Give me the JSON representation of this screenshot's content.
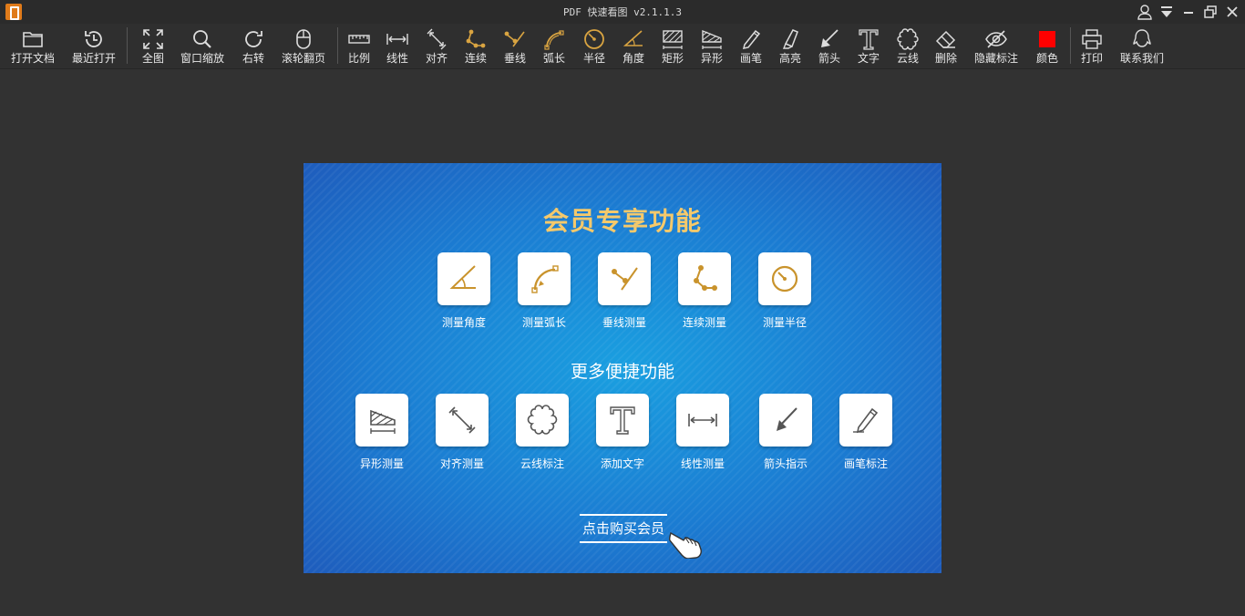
{
  "window": {
    "title": "PDF 快速看图 v2.1.1.3"
  },
  "toolbar": {
    "items": [
      {
        "label": "打开文档",
        "icon": "folder-icon"
      },
      {
        "label": "最近打开",
        "icon": "history-icon"
      },
      {
        "label": "全图",
        "icon": "fullscreen-icon"
      },
      {
        "label": "窗口缩放",
        "icon": "zoom-icon"
      },
      {
        "label": "右转",
        "icon": "rotate-right-icon"
      },
      {
        "label": "滚轮翻页",
        "icon": "mouse-icon"
      },
      {
        "label": "比例",
        "icon": "ruler-icon"
      },
      {
        "label": "线性",
        "icon": "linear-measure-icon"
      },
      {
        "label": "对齐",
        "icon": "align-measure-icon"
      },
      {
        "label": "连续",
        "icon": "continuous-measure-icon"
      },
      {
        "label": "垂线",
        "icon": "perpendicular-icon"
      },
      {
        "label": "弧长",
        "icon": "arc-length-icon"
      },
      {
        "label": "半径",
        "icon": "radius-icon"
      },
      {
        "label": "角度",
        "icon": "angle-icon"
      },
      {
        "label": "矩形",
        "icon": "rectangle-icon"
      },
      {
        "label": "异形",
        "icon": "irregular-shape-icon"
      },
      {
        "label": "画笔",
        "icon": "pen-icon"
      },
      {
        "label": "高亮",
        "icon": "highlighter-icon"
      },
      {
        "label": "箭头",
        "icon": "arrow-icon"
      },
      {
        "label": "文字",
        "icon": "text-icon"
      },
      {
        "label": "云线",
        "icon": "cloud-line-icon"
      },
      {
        "label": "删除",
        "icon": "eraser-icon"
      },
      {
        "label": "隐藏标注",
        "icon": "hide-eye-icon"
      },
      {
        "label": "颜色",
        "icon": "color-swatch"
      },
      {
        "label": "打印",
        "icon": "printer-icon"
      },
      {
        "label": "联系我们",
        "icon": "contact-icon"
      }
    ],
    "colors": {
      "gold": "#d9a441",
      "icon": "#dcdcdc",
      "current_color": "#ff0000"
    }
  },
  "promo": {
    "title": "会员专享功能",
    "vip_features": [
      {
        "label": "测量角度",
        "icon": "angle-icon"
      },
      {
        "label": "测量弧长",
        "icon": "arc-length-icon"
      },
      {
        "label": "垂线测量",
        "icon": "perpendicular-icon"
      },
      {
        "label": "连续测量",
        "icon": "continuous-measure-icon"
      },
      {
        "label": "测量半径",
        "icon": "radius-icon"
      }
    ],
    "subtitle": "更多便捷功能",
    "more_features": [
      {
        "label": "异形测量",
        "icon": "irregular-shape-icon"
      },
      {
        "label": "对齐测量",
        "icon": "align-measure-icon"
      },
      {
        "label": "云线标注",
        "icon": "cloud-line-icon"
      },
      {
        "label": "添加文字",
        "icon": "text-icon"
      },
      {
        "label": "线性测量",
        "icon": "linear-measure-icon"
      },
      {
        "label": "箭头指示",
        "icon": "arrow-icon"
      },
      {
        "label": "画笔标注",
        "icon": "pen-icon"
      }
    ],
    "buy_label": "点击购买会员",
    "colors": {
      "title": "#f5c96b",
      "card_gold": "#c9932c",
      "card_gray": "#555555"
    }
  }
}
